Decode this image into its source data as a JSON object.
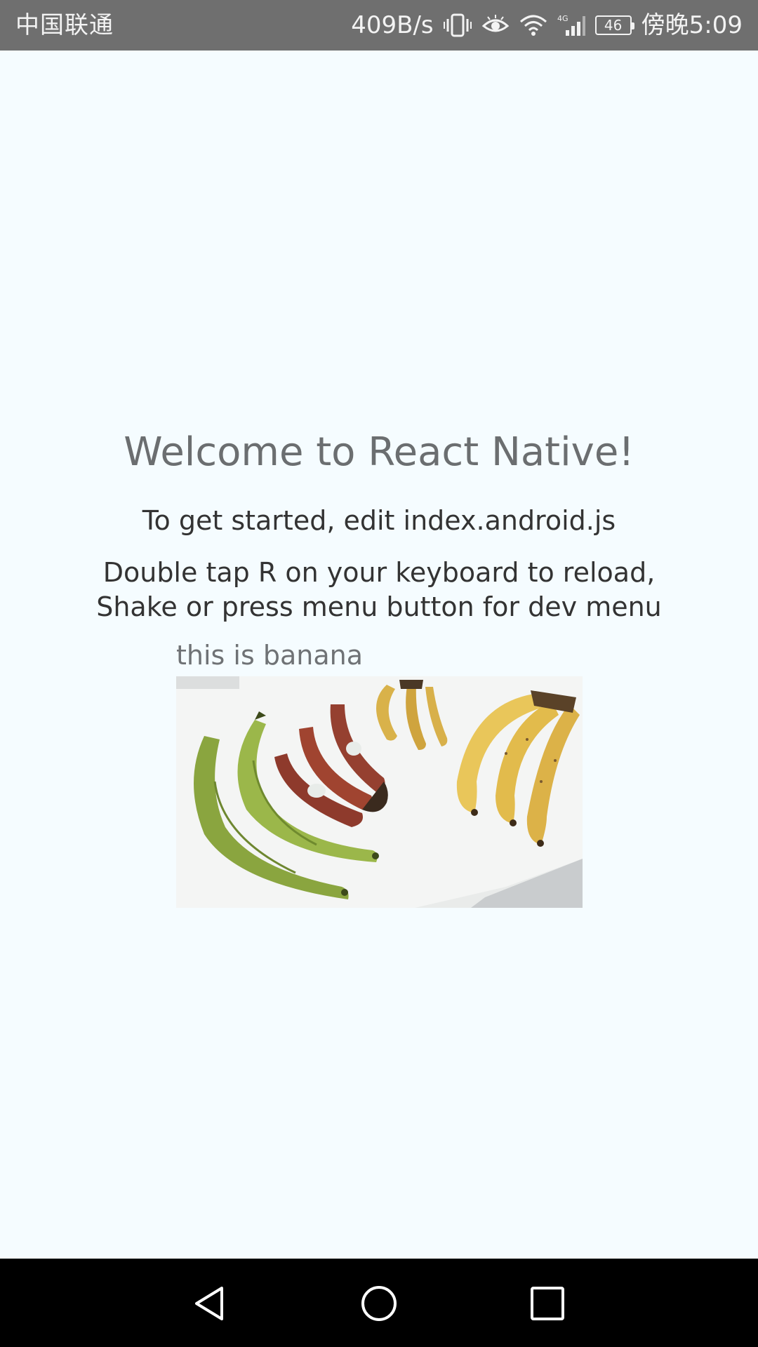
{
  "status_bar": {
    "carrier": "中国联通",
    "net_speed": "409B/s",
    "battery": "46",
    "time": "傍晚5:09",
    "icons": [
      "vibrate-icon",
      "eye-icon",
      "wifi-icon",
      "cellular-4g-icon",
      "battery-icon"
    ]
  },
  "main": {
    "welcome": "Welcome to React Native!",
    "instructions_1": "To get started, edit index.android.js",
    "instructions_2_line1": "Double tap R on your keyboard to reload,",
    "instructions_2_line2": "Shake or press menu button for dev menu",
    "caption": "this is banana"
  },
  "nav_bar": {
    "icons": [
      "back-icon",
      "home-icon",
      "recents-icon"
    ]
  },
  "colors": {
    "background": "#f5fcff",
    "status_bar": "#6f6f6f",
    "nav_bar": "#000000",
    "welcome_text": "#6b6e70",
    "body_text": "#333333"
  }
}
